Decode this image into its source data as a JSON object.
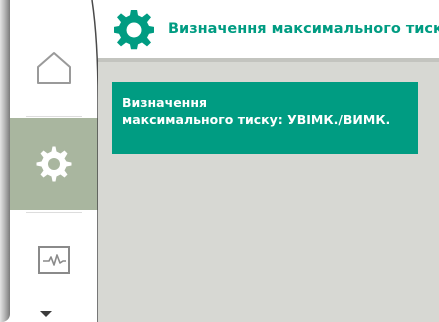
{
  "header": {
    "title": "Визначення максимального тиску",
    "icon": "gear-icon"
  },
  "sidebar": {
    "items": [
      {
        "icon": "home-icon",
        "selected": false
      },
      {
        "icon": "gear-icon",
        "selected": true
      },
      {
        "icon": "status-monitor-icon",
        "selected": false
      }
    ],
    "scroll_indicator": "chevron-down-icon"
  },
  "menu": {
    "items": [
      {
        "label": "Визначення\nмаксимального тиску: УВІМК./ВИМК.",
        "selected": true
      }
    ]
  },
  "colors": {
    "accent": "#009c82",
    "main_background": "#d7d8d3",
    "selected_nav": "#a9b69f",
    "text_on_accent": "#ffffff"
  }
}
